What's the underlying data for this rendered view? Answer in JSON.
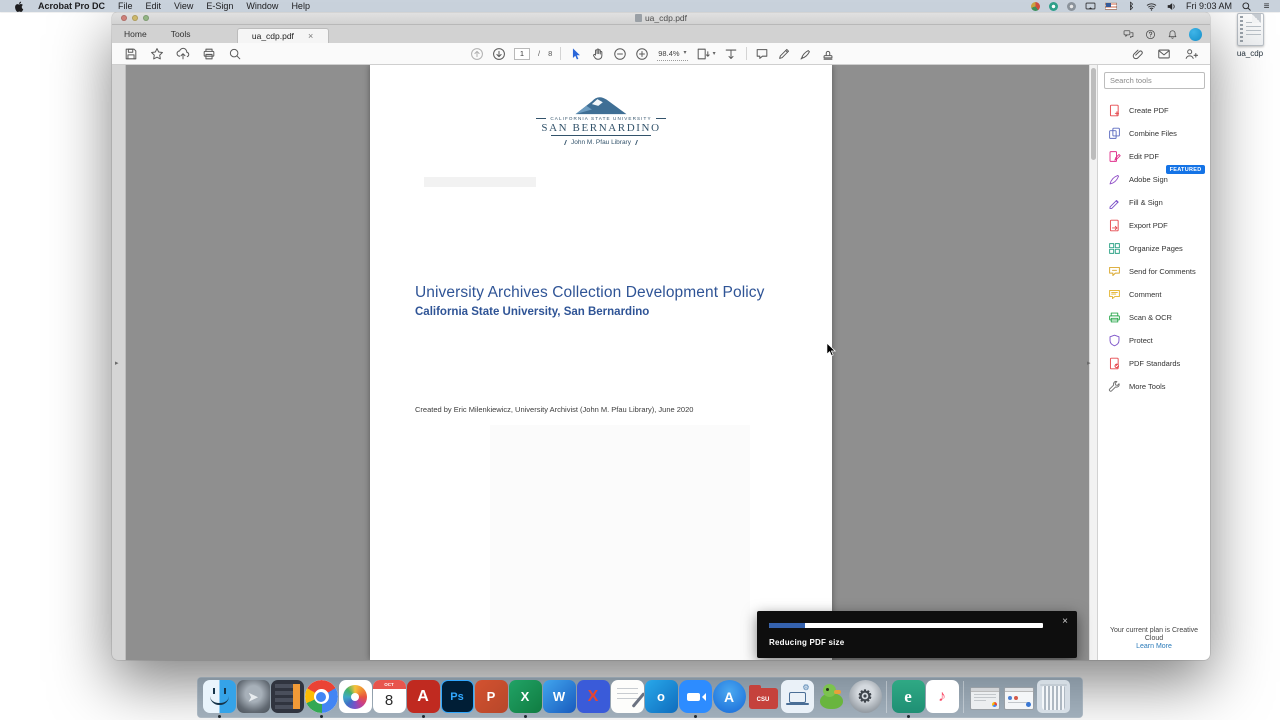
{
  "menu_bar": {
    "app_name": "Acrobat Pro DC",
    "menus": [
      "File",
      "Edit",
      "View",
      "E-Sign",
      "Window",
      "Help"
    ],
    "clock": "Fri 9:03 AM"
  },
  "desktop": {
    "file_label": "ua_cdp"
  },
  "window": {
    "title": "ua_cdp.pdf",
    "tabs": {
      "home": "Home",
      "tools": "Tools",
      "doc": "ua_cdp.pdf"
    },
    "toolbar": {
      "page_current": "1",
      "page_separator": "/",
      "page_total": "8",
      "zoom_value": "98.4%"
    },
    "document": {
      "logo_line1": "CALIFORNIA STATE UNIVERSITY",
      "logo_line2": "SAN BERNARDINO",
      "logo_line3": "John M. Pfau Library",
      "title": "University Archives Collection Development Policy",
      "subtitle": "California State University, San Bernardino",
      "byline": "Created by Eric Milenkiewicz, University Archivist (John M. Pfau Library), June 2020"
    },
    "tools_panel": {
      "search_placeholder": "Search tools",
      "badge_color": "#1473e6",
      "items": [
        {
          "id": "create-pdf",
          "label": "Create PDF",
          "color": "#e5484d"
        },
        {
          "id": "combine-files",
          "label": "Combine Files",
          "color": "#5c6bc0"
        },
        {
          "id": "edit-pdf",
          "label": "Edit PDF",
          "color": "#e0308d"
        },
        {
          "id": "adobe-sign",
          "label": "Adobe Sign",
          "color": "#9353c8",
          "badge": "FEATURED"
        },
        {
          "id": "fill-sign",
          "label": "Fill & Sign",
          "color": "#7d54c9"
        },
        {
          "id": "export-pdf",
          "label": "Export PDF",
          "color": "#e5484d",
          "accent": "#2ca84f"
        },
        {
          "id": "organize-pages",
          "label": "Organize Pages",
          "color": "#2fa387"
        },
        {
          "id": "send-for-comments",
          "label": "Send for Comments",
          "color": "#d9a62a"
        },
        {
          "id": "comment",
          "label": "Comment",
          "color": "#e3b32a"
        },
        {
          "id": "scan-ocr",
          "label": "Scan & OCR",
          "color": "#2ca84f"
        },
        {
          "id": "protect",
          "label": "Protect",
          "color": "#7d54c9"
        },
        {
          "id": "pdf-standards",
          "label": "PDF Standards",
          "color": "#e5484d"
        },
        {
          "id": "more-tools",
          "label": "More Tools",
          "color": "#707070"
        }
      ],
      "plan_text": "Your current plan is Creative Cloud",
      "plan_link": "Learn More"
    },
    "notification": {
      "label": "Reducing PDF size",
      "progress_percent": 13,
      "progress_color": "#3562ae"
    }
  },
  "dock": {
    "items": [
      {
        "id": "finder",
        "running": true
      },
      {
        "id": "launchpad",
        "running": false
      },
      {
        "id": "calculator",
        "running": false
      },
      {
        "id": "chrome",
        "running": true
      },
      {
        "id": "photos",
        "running": false
      },
      {
        "id": "calendar",
        "running": false,
        "month": "OCT",
        "day": "8"
      },
      {
        "id": "acrobat",
        "running": true,
        "text": "A"
      },
      {
        "id": "photoshop",
        "running": false,
        "text": "Ps"
      },
      {
        "id": "powerpoint",
        "running": false,
        "text": "P"
      },
      {
        "id": "excel",
        "running": true,
        "text": "X"
      },
      {
        "id": "word",
        "running": false,
        "text": "W"
      },
      {
        "id": "x-app",
        "running": false,
        "text": "X"
      },
      {
        "id": "notes",
        "running": false
      },
      {
        "id": "outlook",
        "running": false,
        "text": "O"
      },
      {
        "id": "zoom",
        "running": true
      },
      {
        "id": "app-store",
        "running": false,
        "text": "A"
      },
      {
        "id": "csu-folder",
        "running": false,
        "text": "CSU"
      },
      {
        "id": "remote-support",
        "running": false
      },
      {
        "id": "cyberduck",
        "running": false
      },
      {
        "id": "system-preferences",
        "running": false
      },
      {
        "id": "divider"
      },
      {
        "id": "eset",
        "running": true,
        "text": "e"
      },
      {
        "id": "music",
        "running": false,
        "text": "♪"
      },
      {
        "id": "divider"
      },
      {
        "id": "minimized-window-1"
      },
      {
        "id": "minimized-window-2"
      },
      {
        "id": "trash"
      }
    ]
  }
}
